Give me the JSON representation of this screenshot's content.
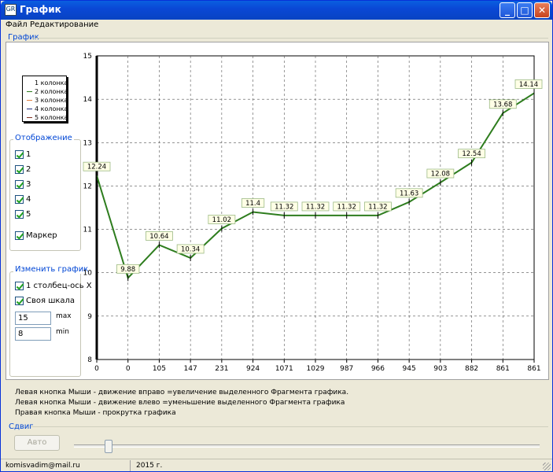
{
  "window": {
    "title": "График",
    "app_icon_text": "GR"
  },
  "titlebar_buttons": {
    "minimize": "_",
    "maximize": "□",
    "close": "✕"
  },
  "menu": [
    "Файл",
    "Редактирование"
  ],
  "group_graph": "График",
  "legend": {
    "items": [
      {
        "label": "1 колонка",
        "color": "#ffffff"
      },
      {
        "label": "2  колонка",
        "color": "#2e7d1e"
      },
      {
        "label": "3  колонка",
        "color": "#e08040"
      },
      {
        "label": "4  колонка",
        "color": "#203080"
      },
      {
        "label": "5 колонка",
        "color": "#803020"
      }
    ]
  },
  "display_group": {
    "title": "Отображение",
    "checks": [
      {
        "label": "1",
        "checked": true
      },
      {
        "label": "2",
        "checked": true
      },
      {
        "label": "3",
        "checked": true
      },
      {
        "label": "4",
        "checked": true
      },
      {
        "label": "5",
        "checked": true
      }
    ],
    "marker": {
      "label": "Маркер",
      "checked": true
    }
  },
  "change_group": {
    "title": "Изменить график",
    "col_axis": "1 столбец-ось X",
    "own_scale": "Своя шкала",
    "max_value": "15",
    "max_label": "max",
    "min_value": "8",
    "min_label": "min"
  },
  "chart_data": {
    "type": "line",
    "categories": [
      "0",
      "0",
      "105",
      "147",
      "231",
      "924",
      "1071",
      "1029",
      "987",
      "966",
      "945",
      "903",
      "882",
      "861",
      "861"
    ],
    "series": [
      {
        "values": [
          12.24,
          9.88,
          10.64,
          10.34,
          11.02,
          11.4,
          11.32,
          11.32,
          11.32,
          11.32,
          11.63,
          12.08,
          12.54,
          13.68,
          14.14
        ],
        "color": "#2e7d1e"
      }
    ],
    "point_labels": [
      "12.24",
      "9.88",
      "10.64",
      "10.34",
      "11.02",
      "11.4",
      "11.32",
      "11.32",
      "11.32",
      "11.32",
      "11.63",
      "12.08",
      "12.54",
      "13.68",
      "14.14"
    ],
    "y_ticks": [
      "8",
      "9",
      "10",
      "11",
      "12",
      "13",
      "14",
      "15"
    ],
    "ylim": [
      8,
      15
    ],
    "grid": true,
    "grid_style": "dashed"
  },
  "help_lines": [
    "Левая кнопка  Мыши - движение вправо =увеличение выделенного Фрагмента графика.",
    "Левая кнопка  Мыши - движение влево =уменьшение выделенного Фрагмента графика",
    "Правая кнопка  Мыши - прокрутка графика"
  ],
  "shift_group": "Сдвиг",
  "auto_button": "Авто",
  "status": {
    "email": "komisvadim@mail.ru",
    "year": "2015 г."
  }
}
